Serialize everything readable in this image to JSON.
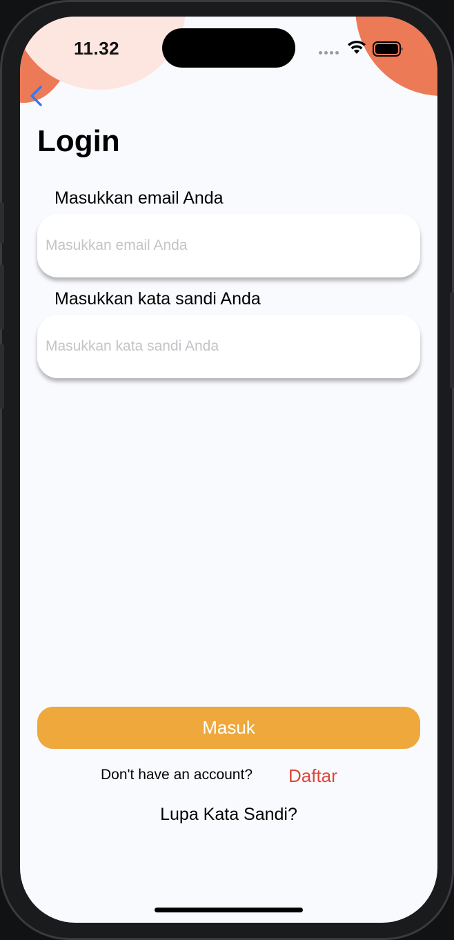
{
  "status_bar": {
    "time": "11.32"
  },
  "colors": {
    "accent_orange": "#eea83b",
    "blob_orange": "#ec7a57",
    "blob_peach": "#fde6df",
    "link_red": "#e0443a",
    "back_blue": "#2f7bf5"
  },
  "header": {
    "back_icon": "chevron-left-icon",
    "title": "Login"
  },
  "form": {
    "email": {
      "label": "Masukkan email Anda",
      "placeholder": "Masukkan email Anda",
      "value": ""
    },
    "password": {
      "label": "Masukkan kata sandi Anda",
      "placeholder": "Masukkan kata sandi Anda",
      "value": ""
    }
  },
  "actions": {
    "login_button": "Masuk",
    "signup_prompt": "Don't have an account?",
    "signup_link": "Daftar",
    "forgot_password": "Lupa Kata Sandi?"
  }
}
